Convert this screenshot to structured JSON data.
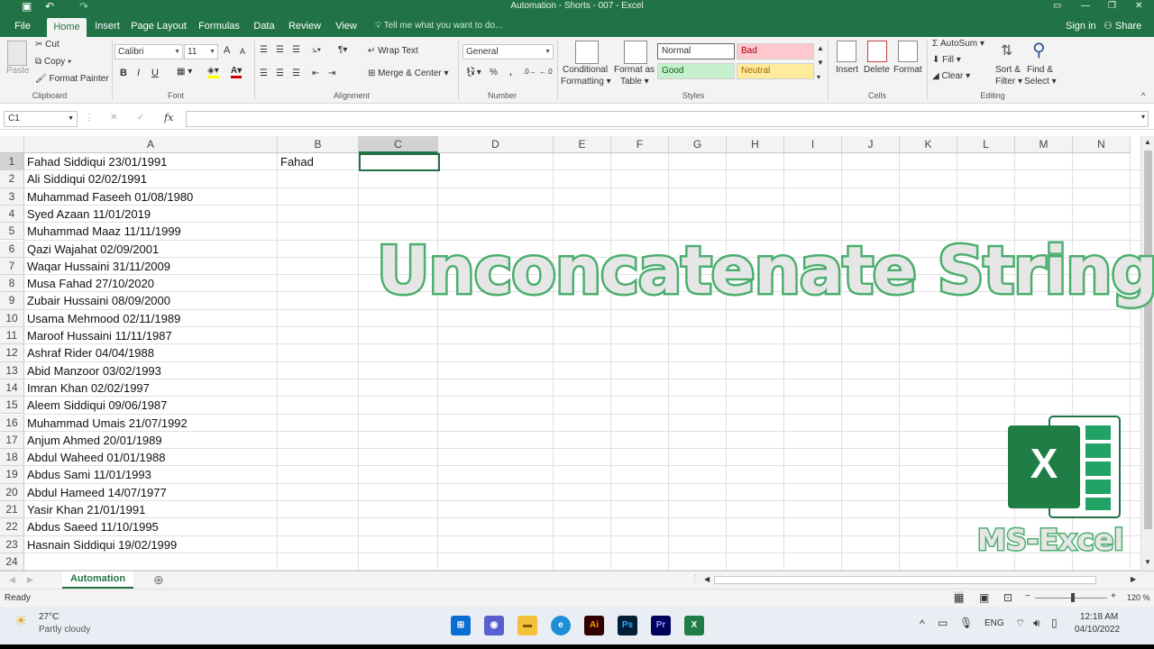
{
  "window": {
    "title": "Automation - Shorts - 007 - Excel"
  },
  "tabs": [
    "File",
    "Home",
    "Insert",
    "Page Layout",
    "Formulas",
    "Data",
    "Review",
    "View"
  ],
  "tell_me": "Tell me what you want to do...",
  "sign_in": "Sign in",
  "share": "Share",
  "ribbon": {
    "clipboard": {
      "paste": "Paste",
      "cut": "Cut",
      "copy": "Copy",
      "format_painter": "Format Painter",
      "label": "Clipboard"
    },
    "font": {
      "name": "Calibri",
      "size": "11",
      "label": "Font",
      "bold": "B",
      "italic": "I",
      "underline": "U",
      "grow": "A",
      "shrink": "A"
    },
    "alignment": {
      "wrap": "Wrap Text",
      "merge": "Merge & Center",
      "label": "Alignment"
    },
    "number": {
      "format": "General",
      "percent": "%",
      "comma": ",",
      "label": "Number"
    },
    "styles": {
      "conditional": "Conditional",
      "formatting": "Formatting",
      "format_as": "Format as",
      "table": "Table",
      "normal": "Normal",
      "bad": "Bad",
      "good": "Good",
      "neutral": "Neutral",
      "label": "Styles"
    },
    "cells": {
      "insert": "Insert",
      "delete": "Delete",
      "format": "Format",
      "label": "Cells"
    },
    "editing": {
      "autosum": "AutoSum",
      "fill": "Fill",
      "clear": "Clear",
      "sort": "Sort &",
      "filter": "Filter",
      "find": "Find &",
      "select": "Select",
      "label": "Editing"
    }
  },
  "formula_bar": {
    "name_box": "C1",
    "fx": "fx",
    "cancel": "✕",
    "enter": "✓",
    "content": ""
  },
  "columns": [
    "A",
    "B",
    "C",
    "D",
    "E",
    "F",
    "G",
    "H",
    "I",
    "J",
    "K",
    "L",
    "M",
    "N"
  ],
  "rows": [
    {
      "n": "1",
      "a": "Fahad Siddiqui 23/01/1991",
      "b": "Fahad"
    },
    {
      "n": "2",
      "a": "Ali Siddiqui 02/02/1991",
      "b": ""
    },
    {
      "n": "3",
      "a": "Muhammad Faseeh 01/08/1980",
      "b": ""
    },
    {
      "n": "4",
      "a": "Syed Azaan 11/01/2019",
      "b": ""
    },
    {
      "n": "5",
      "a": "Muhammad Maaz 11/11/1999",
      "b": ""
    },
    {
      "n": "6",
      "a": "Qazi Wajahat 02/09/2001",
      "b": ""
    },
    {
      "n": "7",
      "a": "Waqar Hussaini 31/11/2009",
      "b": ""
    },
    {
      "n": "8",
      "a": "Musa Fahad 27/10/2020",
      "b": ""
    },
    {
      "n": "9",
      "a": "Zubair Hussaini 08/09/2000",
      "b": ""
    },
    {
      "n": "10",
      "a": "Usama Mehmood 02/11/1989",
      "b": ""
    },
    {
      "n": "11",
      "a": "Maroof Hussaini 11/11/1987",
      "b": ""
    },
    {
      "n": "12",
      "a": "Ashraf Rider 04/04/1988",
      "b": ""
    },
    {
      "n": "13",
      "a": "Abid Manzoor 03/02/1993",
      "b": ""
    },
    {
      "n": "14",
      "a": "Imran Khan 02/02/1997",
      "b": ""
    },
    {
      "n": "15",
      "a": "Aleem Siddiqui 09/06/1987",
      "b": ""
    },
    {
      "n": "16",
      "a": "Muhammad Umais 21/07/1992",
      "b": ""
    },
    {
      "n": "17",
      "a": "Anjum Ahmed 20/01/1989",
      "b": ""
    },
    {
      "n": "18",
      "a": "Abdul Waheed 01/01/1988",
      "b": ""
    },
    {
      "n": "19",
      "a": "Abdus Sami 11/01/1993",
      "b": ""
    },
    {
      "n": "20",
      "a": "Abdul Hameed 14/07/1977",
      "b": ""
    },
    {
      "n": "21",
      "a": "Yasir Khan 21/01/1991",
      "b": ""
    },
    {
      "n": "22",
      "a": "Abdus Saeed 11/10/1995",
      "b": ""
    },
    {
      "n": "23",
      "a": "Hasnain Siddiqui 19/02/1999",
      "b": ""
    },
    {
      "n": "24",
      "a": "",
      "b": ""
    }
  ],
  "overlay": {
    "title": "Unconcatenate String",
    "ms_label": "MS-Excel",
    "logo_letter": "X"
  },
  "sheet_tab": "Automation",
  "status": {
    "ready": "Ready",
    "zoom": "120 %"
  },
  "taskbar": {
    "temp": "27°C",
    "weather": "Partly cloudy",
    "lang": "ENG",
    "time": "12:18 AM",
    "date": "04/10/2022"
  },
  "colors": {
    "excel_green": "#217346",
    "overlay_green": "#4cae6e"
  }
}
